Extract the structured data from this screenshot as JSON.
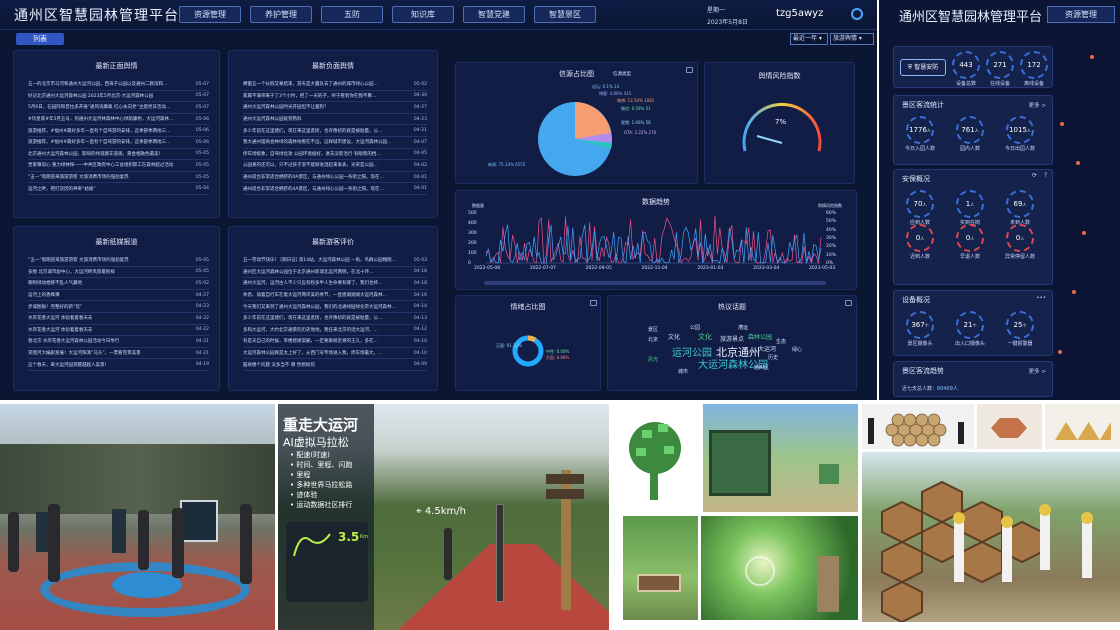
{
  "header": {
    "title": "通州区智慧园林管理平台",
    "nav": [
      "资源管理",
      "养护管理",
      "五防",
      "知识库",
      "智慧党建",
      "智慧景区"
    ],
    "weekday": "星期一",
    "date": "2023年5月8日",
    "username": "tzg5awyz",
    "settings_icon": "gear-icon"
  },
  "toolbar": {
    "list_tab": "列表",
    "range_select": "最近一年",
    "topic_select": "旅游舆情"
  },
  "panels": {
    "latest_positive": {
      "title": "最新正面舆情",
      "rows": [
        {
          "t": "五一的北京市马河和通州大运河公园，西海子公园以及通州二教滨和…",
          "d": "05-07"
        },
        {
          "t": "好记北京通州大运河森林公园 2023年5月北京·大运河森林公园",
          "d": "05-07"
        },
        {
          "t": "5月6日，石园际和普拉多开展“通风询康桑 红心永向党”主题党日活动…",
          "d": "05-07"
        },
        {
          "t": "#玩星家#年5月五号，到通州大运河林森林中心绿荫康桥，大运河森林…",
          "d": "05-06"
        },
        {
          "t": "旅游推荐，#福州#最好多年一直有个自驾游的安排，这季部季两地三…",
          "d": "05-06"
        },
        {
          "t": "旅游推荐，#福州#最好多年一直有个自驾游的安排，这季部季两地三…",
          "d": "05-06"
        },
        {
          "t": "北京通州大运河森林公园，影响的绿道路车道观，黄金相融色最美！",
          "d": "05-05"
        },
        {
          "t": "贾家镇母心 重力绿林探——中共区政府中心工会组织职工在森林超过活动",
          "d": "05-05"
        },
        {
          "t": "“五一”假期迎来旅游游客 文旅消费市场的强劲复苏",
          "d": "05-05"
        },
        {
          "t": "运河之畔，把打双因的神奇“姑娘”",
          "d": "05-04"
        }
      ]
    },
    "latest_negative": {
      "title": "最新负面舆情",
      "rows": [
        {
          "t": "蝉蜜五一个长假又要结束，游天是大露队去了通州的城市绿心公园…",
          "d": "05-02"
        },
        {
          "t": "家属不满带来于了3个小时，把了一天的子，终于看到你在我不算…",
          "d": "04-30"
        },
        {
          "t": "通州大运河森林公园时光开园但不让遛狗？",
          "d": "04-27"
        },
        {
          "t": "通州大运河森林公园就到熟料",
          "d": "04-23"
        },
        {
          "t": "多少年前在这里建们，现在来这里逛街，也许像初的就是被贴量，公…",
          "d": "04-21"
        },
        {
          "t": "我大通州理商会林绿的森林地看在不远，这样城市建设，大运河森林公园…",
          "d": "04-07"
        },
        {
          "t": "停车场极象，自驾绿化攻 公园环境极好，进去没影治行 有眼帮的挡…",
          "d": "04-05"
        },
        {
          "t": "公园真的还可以，只不过孩子湿不能够进湿起来发表，光荣是公园…",
          "d": "04-02"
        },
        {
          "t": "通州适合非常适合拥挤的4A景区，与通州绿心公园一条街之隔，现在…",
          "d": "04-01"
        },
        {
          "t": "通州适合非常适合拥挤的4A景区，与通州绿心公园一条街之隔，现在…",
          "d": "04-01"
        }
      ]
    },
    "latest_paper": {
      "title": "最新纸媒报道",
      "rows": [
        {
          "t": "“五一”假期迎来旅游游客 文旅消费市场的强劲复苏",
          "d": "05-05"
        },
        {
          "t": "多图 北京城市副中心，大运河畔风景最别样",
          "d": "05-05"
        },
        {
          "t": "聊和绿动相继不乱人气藏地",
          "d": "05-02"
        },
        {
          "t": "运河上的香樟薄",
          "d": "04-27"
        },
        {
          "t": "步城图报！完整好的新“玩”",
          "d": "04-23"
        },
        {
          "t": "水岸花香大运河 体验着着春天去",
          "d": "04-22"
        },
        {
          "t": "水岸花香大运河 体验着着春天去",
          "d": "04-22"
        },
        {
          "t": "春北京 水岸花香大运河森林公园活动今日举行",
          "d": "04-21"
        },
        {
          "t": "赏图河大编剧发展！大运河辉演“马头”，一票看完景美景",
          "d": "04-21"
        },
        {
          "t": "这个春天，来大运河园赏醒越越人美景！",
          "d": "04-19"
        }
      ]
    },
    "latest_reviews": {
      "title": "最新游客评价",
      "rows": [
        {
          "t": "五一劳动节快乐！ [期日记] 第14站，大运河森林公园 —角，鸟群公园翱翔…",
          "d": "05-03"
        },
        {
          "t": "通州区大运河森林公园位于北京通州新城北运河两侧，在北十环…",
          "d": "04-18"
        },
        {
          "t": "通州大运河，运河古人不少只应有粉多半人生命要有哪了，我们也终…",
          "d": "04-18"
        },
        {
          "t": "休息。骑着自行车在着大运河两岸美的季节，一直感湖湖湖大运河森林…",
          "d": "04-16"
        },
        {
          "t": "今天我们又来到了通州大运河森林公园，我们的北通绿园绿化带大运河森林…",
          "d": "04-14"
        },
        {
          "t": "多少年前在这里建们，现在来这里逛街，也许像初的就是被贴量，公…",
          "d": "04-13"
        },
        {
          "t": "多和大运河，大约北京通景的历史地地，我任来北京的话大运河，…",
          "d": "04-12"
        },
        {
          "t": "有是天自己的时候，率楼感谢案删，一定要跟很近将的王久，多在…",
          "d": "04-10"
        },
        {
          "t": "大运河森林公园真是太上好了，从西门号专场进入我，停车场最大，…",
          "d": "04-10"
        },
        {
          "t": "脑商楼个问题 没多当不 哪 然想如何",
          "d": "04-09"
        }
      ]
    }
  },
  "charts_text": {
    "source_title": "信源占比图",
    "source_subtitle": "信源类型",
    "source_labels": [
      "新闻: 75.14% 6555",
      "论坛: 0.1% 14",
      "博客: 4.86% 415",
      "微博: 13.54% 1081",
      "微信: 0.59% 51",
      "视频: 1.66% 58",
      "OTA: 2.22% 270"
    ],
    "gauge_title": "舆情风险指数",
    "gauge_value": "7%",
    "trend_title": "数据趋势",
    "trend_ylabel": "数据量",
    "trend_y2label": "舆情风险指数",
    "trend_x": [
      "2022-05-08",
      "2022-07-07",
      "2022-09-05",
      "2022-11-04",
      "2023-01-03",
      "2023-03-04",
      "2023-05-03"
    ],
    "trend_y": [
      "500",
      "400",
      "300",
      "200",
      "100",
      "0"
    ],
    "trend_y2": [
      "60%",
      "50%",
      "40%",
      "30%",
      "20%",
      "10%",
      "0%"
    ],
    "emotion_title": "情绪占比图",
    "emotion_labels": [
      "正面: 91.12%",
      "中性: 0.00%",
      "负面: 8.88%"
    ],
    "hot_title": "热议话题",
    "words": [
      "运河公园",
      "北京通州",
      "大运河森林公园",
      "文化",
      "旅游景点",
      "文化",
      "森林公园",
      "大运河",
      "北京",
      "历史",
      "城市",
      "风光",
      "生态",
      "景区",
      "通州区",
      "公园",
      "漕运",
      "绿心"
    ]
  },
  "side": {
    "title": "通州区智慧园林管理平台",
    "nav": "资源管理",
    "safety": {
      "label": "智慧安防",
      "items": [
        {
          "v": "443",
          "l": "设备总数"
        },
        {
          "v": "271",
          "l": "在线设备"
        },
        {
          "v": "172",
          "l": "离线设备"
        }
      ]
    },
    "flow": {
      "title": "景区客流统计",
      "more": "更多 >",
      "items": [
        {
          "v": "1776",
          "u": "人",
          "l": "今日入园人数"
        },
        {
          "v": "761",
          "u": "人",
          "l": "园内人数"
        },
        {
          "v": "1015",
          "u": "人",
          "l": "今日出园人数"
        }
      ]
    },
    "security": {
      "title": "安保概况",
      "items": [
        {
          "v": "70",
          "u": "人",
          "l": "应到人数"
        },
        {
          "v": "1",
          "u": "人",
          "l": "实到在岗"
        },
        {
          "v": "69",
          "u": "人",
          "l": "未到人数"
        },
        {
          "v": "0",
          "u": "人",
          "l": "迟到人数"
        },
        {
          "v": "0",
          "u": "人",
          "l": "早退人数"
        },
        {
          "v": "0",
          "u": "人",
          "l": "异常停留人数"
        }
      ]
    },
    "devices": {
      "title": "设备概况",
      "items": [
        {
          "v": "367",
          "u": "个",
          "l": "景区摄像头"
        },
        {
          "v": "21",
          "u": "个",
          "l": "出入口摄像头"
        },
        {
          "v": "25",
          "u": "个",
          "l": "一键报警器"
        }
      ]
    },
    "trend": {
      "title": "景区客流趋势",
      "more": "更多 >",
      "week_label": "近七天总人数：",
      "week_value": "80409人"
    }
  },
  "photos": {
    "run_title": "重走大运河",
    "run_sub": "AI虚拟马拉松",
    "run_bullets": [
      "配速(时速)",
      "时间、里程、闪跑",
      "里程",
      "多种世界马拉松路",
      "迹体验",
      "运动数据社区排行"
    ],
    "speed_overlay": "4.5km/h",
    "pace": "3.5",
    "pace_unit": "Km"
  }
}
